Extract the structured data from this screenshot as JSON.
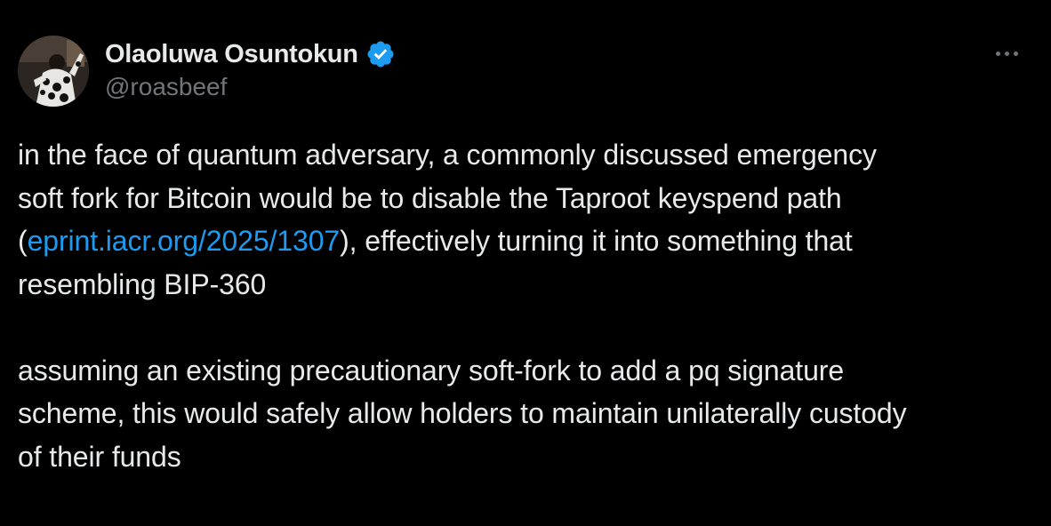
{
  "author": {
    "display_name": "Olaoluwa Osuntokun",
    "handle": "@roasbeef",
    "verified": true,
    "avatar_icon": "avatar-photo"
  },
  "more_icon": "more-dots-icon",
  "colors": {
    "background": "#000000",
    "text": "#e7e9ea",
    "secondary": "#71767b",
    "link": "#1d9bf0",
    "verified": "#1d9bf0"
  },
  "tweet": {
    "para1": {
      "line1": "in the face of quantum adversary, a commonly discussed emergency",
      "line2": "soft fork for Bitcoin would be to disable the Taproot keyspend path",
      "line3_prefix": "(",
      "link_text": "eprint.iacr.org/2025/1307",
      "line3_suffix": "), effectively turning it into something that",
      "line4": "resembling BIP-360"
    },
    "para2": {
      "line1": "assuming an existing precautionary soft-fork to add a pq signature",
      "line2": "scheme, this would safely allow holders to maintain unilaterally custody",
      "line3": "of their funds"
    }
  }
}
